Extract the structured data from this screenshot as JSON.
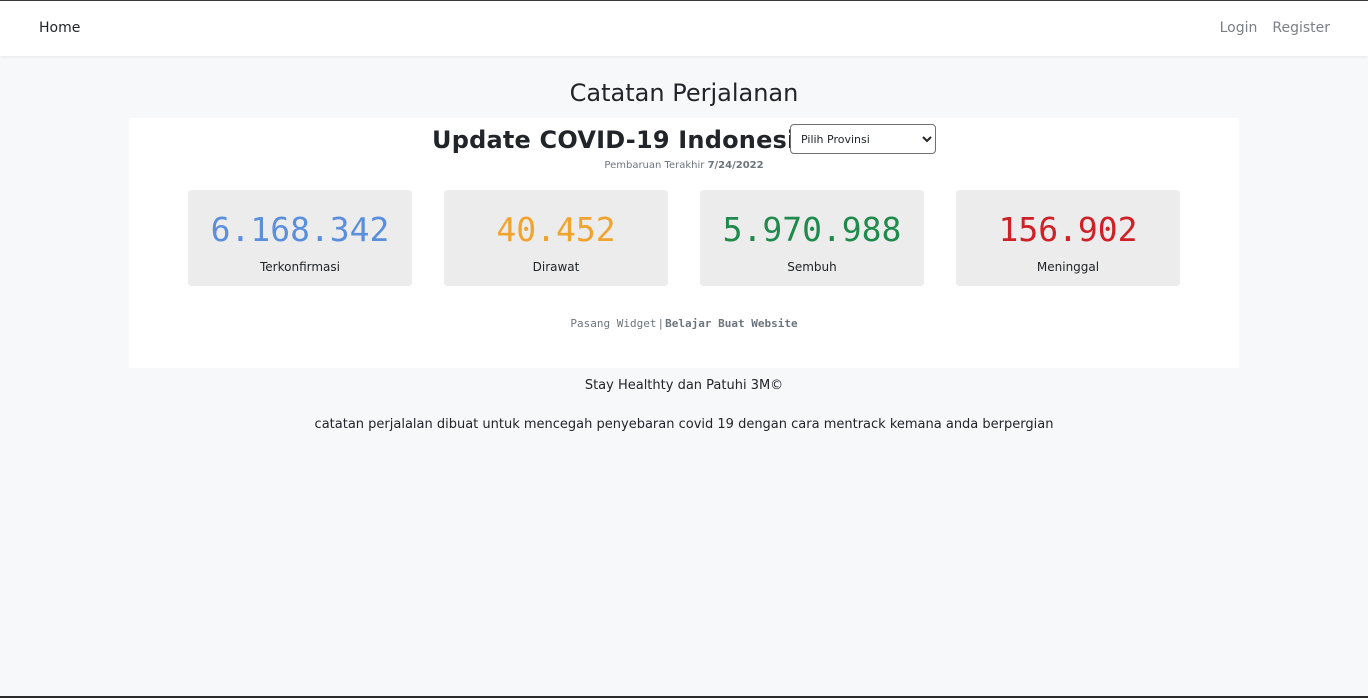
{
  "nav": {
    "home_label": "Home",
    "login_label": "Login",
    "register_label": "Register"
  },
  "page": {
    "title": "Catatan Perjalanan"
  },
  "widget": {
    "title": "Update COVID-19 Indonesia",
    "province_select": {
      "selected": "Pilih Provinsi"
    },
    "updated_prefix": "Pembaruan Terakhir",
    "updated_date": "7/24/2022",
    "stats": [
      {
        "value": "6.168.342",
        "label": "Terkonfirmasi",
        "color": "#5b8fdc"
      },
      {
        "value": "40.452",
        "label": "Dirawat",
        "color": "#f0a42e"
      },
      {
        "value": "5.970.988",
        "label": "Sembuh",
        "color": "#1f8a4c"
      },
      {
        "value": "156.902",
        "label": "Meninggal",
        "color": "#cf2027"
      }
    ],
    "link_widget": "Pasang Widget",
    "link_separator": "|",
    "link_learn": "Belajar Buat Website"
  },
  "footer": {
    "tagline": "Stay Healthty dan Patuhi 3M©",
    "description": "catatan perjalalan dibuat untuk mencegah penyebaran covid 19 dengan cara mentrack kemana anda berpergian"
  },
  "colors": {
    "page_background": "#f7f8fa",
    "navbar_background": "#ffffff",
    "card_background": "#ececec"
  }
}
